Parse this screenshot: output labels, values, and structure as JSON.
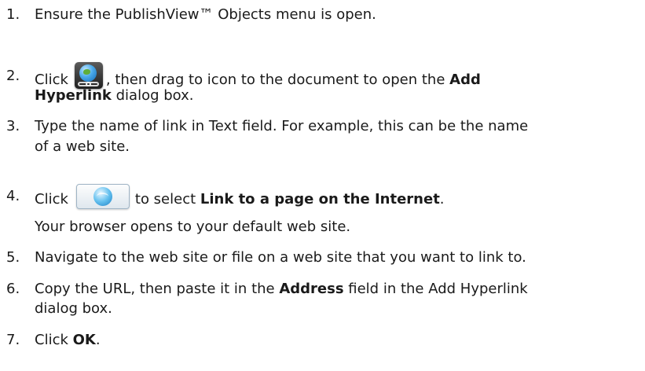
{
  "steps": [
    {
      "num": "1.",
      "text": "Ensure the PublishView™ Objects menu is open."
    },
    {
      "num": "2.",
      "pre": "Click",
      "mid": ", then drag to icon to the document to open the ",
      "bold1": "Add",
      "line2_bold": "Hyperlink",
      "line2_rest": " dialog box.",
      "icon": "globe-hyperlink-icon"
    },
    {
      "num": "3.",
      "line1": "Type the name of link in Text field. For example, this can be the name",
      "line2": "of a web site."
    },
    {
      "num": "4.",
      "pre": "Click",
      "mid": "to select ",
      "bold": "Link to a page on the Internet",
      "post": ".",
      "icon": "globe-link-button-icon"
    },
    {
      "sub": "Your browser opens to your default web site."
    },
    {
      "num": "5.",
      "text": "Navigate to the web site or file on a web site that you want to link to."
    },
    {
      "num": "6.",
      "pre": "Copy the URL, then paste it in the ",
      "bold": "Address",
      "post": " field in the Add Hyperlink",
      "line2": "dialog box."
    },
    {
      "num": "7.",
      "pre": "Click ",
      "bold": "OK",
      "post": "."
    }
  ]
}
